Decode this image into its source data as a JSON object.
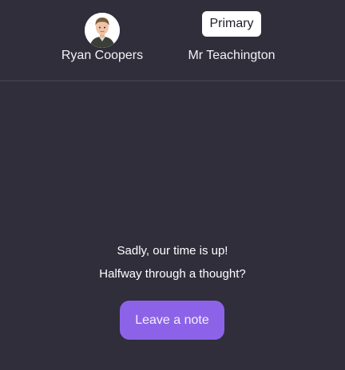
{
  "header": {
    "student": {
      "name": "Ryan Coopers",
      "avatar": "student-photo"
    },
    "teacher": {
      "badge": "Primary",
      "name": "Mr Teachington"
    }
  },
  "message": {
    "line1": "Sadly, our time is up!",
    "line2": "Halfway through a thought?"
  },
  "actions": {
    "leave_note_label": "Leave a note"
  },
  "colors": {
    "background": "#302e3b",
    "divider": "#4a4856",
    "accent": "#8c63e8",
    "text": "#ffffff"
  }
}
